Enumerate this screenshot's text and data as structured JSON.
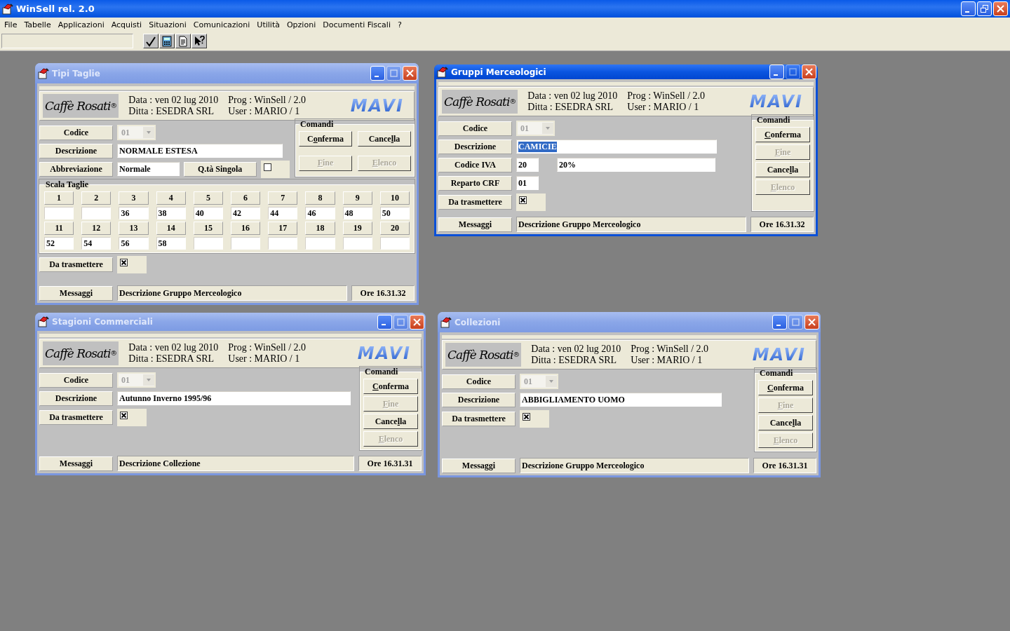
{
  "app": {
    "title": "WinSell rel. 2.0"
  },
  "menu": [
    "File",
    "Tabelle",
    "Applicazioni",
    "Acquisti",
    "Situazioni",
    "Comunicazioni",
    "Utilità",
    "Opzioni",
    "Documenti Fiscali",
    "?"
  ],
  "windows": [
    {
      "title": "Tipi Taglie",
      "active": false,
      "header": {
        "logo": "Caffè Rosati$^{®}$",
        "lines": [
          "Data : ven 02 lug 2010",
          "Ditta : ESEDRA SRL",
          "Prog : WinSell / 2.0",
          "User : MARIO / 1"
        ],
        "brand": "MAVI"
      },
      "rows": [
        {
          "kind": "combo",
          "label": "Codice",
          "value": "01"
        },
        {
          "kind": "text",
          "label": "Descrizione",
          "value": "NORMALE ESTESA",
          "highlighted": false
        },
        {
          "kind": "abbrev",
          "label": "Abbreviazione",
          "value": "Normale",
          "option_label": "Q.tà Singola",
          "option_checked": false
        }
      ],
      "commands_title": "Comandi",
      "commands": [
        {
          "before": "C",
          "key": "o",
          "after": "nferma",
          "disabled": false
        },
        {
          "before": "Cance",
          "key": "l",
          "after": "la",
          "disabled": false
        },
        {
          "key": "F",
          "after": "ine",
          "disabled": true
        },
        {
          "key": "E",
          "after": "lenco",
          "disabled": true
        }
      ],
      "sizes_title": "Scala Taglie",
      "sizes": [
        {
          "label": "1"
        },
        {
          "label": "2"
        },
        {
          "label": "3",
          "value": "36"
        },
        {
          "label": "4",
          "value": "38"
        },
        {
          "label": "5",
          "value": "40"
        },
        {
          "label": "6",
          "value": "42"
        },
        {
          "label": "7",
          "value": "44"
        },
        {
          "label": "8",
          "value": "46"
        },
        {
          "label": "9",
          "value": "48"
        },
        {
          "label": "10",
          "value": "50"
        },
        {
          "label": "11",
          "value": "52"
        },
        {
          "label": "12",
          "value": "54"
        },
        {
          "label": "13",
          "value": "56"
        },
        {
          "label": "14",
          "value": "58"
        },
        {
          "label": "15"
        },
        {
          "label": "16"
        },
        {
          "label": "17"
        },
        {
          "label": "18"
        },
        {
          "label": "19"
        },
        {
          "label": "20"
        }
      ],
      "rows_below": [
        {
          "kind": "check",
          "label": "Da trasmettere",
          "checked": true
        }
      ],
      "footer": {
        "label": "Messaggi",
        "message": "Descrizione Gruppo Merceologico",
        "time": "Ore 16.31.32"
      }
    },
    {
      "title": "Gruppi Merceologici",
      "active": true,
      "header": {
        "logo": "Caffè Rosati$^{®}$",
        "lines": [
          "Data : ven 02 lug 2010",
          "Ditta : ESEDRA SRL",
          "Prog : WinSell / 2.0",
          "User : MARIO / 1"
        ],
        "brand": "MAVI"
      },
      "rows": [
        {
          "kind": "combo",
          "label": "Codice",
          "value": "01"
        },
        {
          "kind": "text",
          "label": "Descrizione",
          "value": "CAMICIE",
          "highlighted": true
        },
        {
          "kind": "pair",
          "label": "Codice IVA",
          "value": "20",
          "detail": "20%"
        },
        {
          "kind": "short",
          "label": "Reparto CRF",
          "value": "01"
        },
        {
          "kind": "check",
          "label": "Da trasmettere",
          "checked": true
        }
      ],
      "commands_title": "Comandi",
      "commands": [
        {
          "key": "C",
          "after": "onferma",
          "disabled": false
        },
        {
          "key": "F",
          "after": "ine",
          "disabled": true
        },
        {
          "before": "Cance",
          "key": "l",
          "after": "la",
          "disabled": false
        },
        {
          "key": "E",
          "after": "lenco",
          "disabled": true
        }
      ],
      "footer": {
        "label": "Messaggi",
        "message": "Descrizione Gruppo Merceologico",
        "time": "Ore 16.31.32"
      }
    },
    {
      "title": "Stagioni Commerciali",
      "active": false,
      "header": {
        "logo": "Caffè Rosati$^{®}$",
        "lines": [
          "Data : ven 02 lug 2010",
          "Ditta : ESEDRA SRL",
          "Prog : WinSell / 2.0",
          "User : MARIO / 1"
        ],
        "brand": "MAVI"
      },
      "rows": [
        {
          "kind": "combo",
          "label": "Codice",
          "value": "01"
        },
        {
          "kind": "text",
          "label": "Descrizione",
          "value": "Autunno Inverno 1995/96",
          "highlighted": false
        },
        {
          "kind": "check",
          "label": "Da trasmettere",
          "checked": true
        }
      ],
      "commands_title": "Comandi",
      "commands": [
        {
          "key": "C",
          "after": "onferma",
          "disabled": false
        },
        {
          "key": "F",
          "after": "ine",
          "disabled": true
        },
        {
          "before": "Cance",
          "key": "l",
          "after": "la",
          "disabled": false
        },
        {
          "key": "E",
          "after": "lenco",
          "disabled": true
        }
      ],
      "footer": {
        "label": "Messaggi",
        "message": "Descrizione Collezione",
        "time": "Ore 16.31.31"
      }
    },
    {
      "title": "Collezioni",
      "active": false,
      "header": {
        "logo": "Caffè Rosati$^{®}$",
        "lines": [
          "Data : ven 02 lug 2010",
          "Ditta : ESEDRA SRL",
          "Prog : WinSell / 2.0",
          "User : MARIO / 1"
        ],
        "brand": "MAVI"
      },
      "rows": [
        {
          "kind": "combo",
          "label": "Codice",
          "value": "01"
        },
        {
          "kind": "text",
          "label": "Descrizione",
          "value": "ABBIGLIAMENTO UOMO",
          "highlighted": false
        },
        {
          "kind": "check",
          "label": "Da trasmettere",
          "checked": true
        }
      ],
      "commands_title": "Comandi",
      "commands": [
        {
          "key": "C",
          "after": "onferma",
          "disabled": false
        },
        {
          "key": "F",
          "after": "ine",
          "disabled": true
        },
        {
          "before": "Cance",
          "key": "l",
          "after": "la",
          "disabled": false
        },
        {
          "key": "E",
          "after": "lenco",
          "disabled": true
        }
      ],
      "footer": {
        "label": "Messaggi",
        "message": "Descrizione Gruppo Merceologico",
        "time": "Ore 16.31.31"
      }
    }
  ]
}
